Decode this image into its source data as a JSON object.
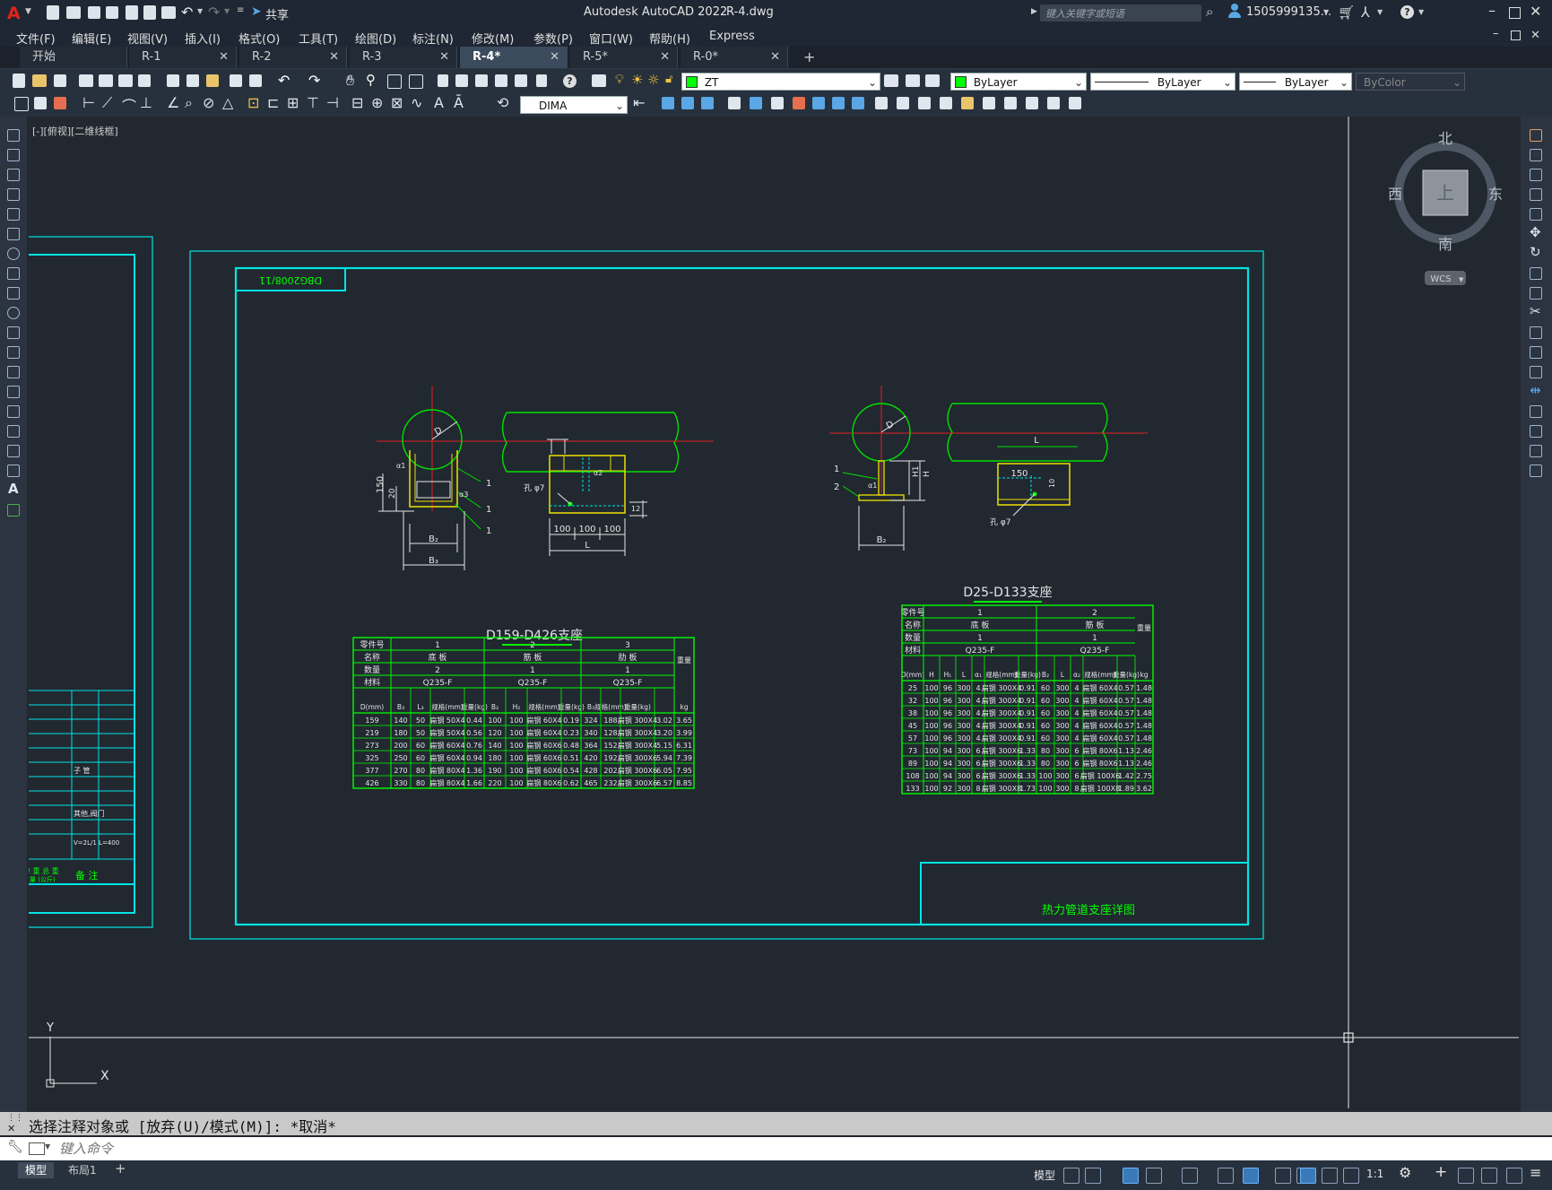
{
  "app": {
    "title": "Autodesk AutoCAD 2022",
    "filename": "R-4.dwg",
    "share_label": "共享",
    "search_placeholder": "键入关键字或短语",
    "user": "1505999135...",
    "accent": "#e2231a"
  },
  "menu": [
    "文件(F)",
    "编辑(E)",
    "视图(V)",
    "插入(I)",
    "格式(O)",
    "工具(T)",
    "绘图(D)",
    "标注(N)",
    "修改(M)",
    "参数(P)",
    "窗口(W)",
    "帮助(H)",
    "Express"
  ],
  "tabs": [
    {
      "label": "开始",
      "active": false,
      "close": false
    },
    {
      "label": "R-1",
      "active": false,
      "close": true
    },
    {
      "label": "R-2",
      "active": false,
      "close": true
    },
    {
      "label": "R-3",
      "active": false,
      "close": true
    },
    {
      "label": "R-4*",
      "active": true,
      "close": true
    },
    {
      "label": "R-5*",
      "active": false,
      "close": true
    },
    {
      "label": "R-0*",
      "active": false,
      "close": true
    }
  ],
  "toolbar": {
    "layer": "ZT",
    "color": "ByLayer",
    "linetype": "ByLayer",
    "lineweight": "ByLayer",
    "plotstyle": "ByColor",
    "dimstyle": "DIMA"
  },
  "viewport": {
    "label": "[-][俯视][二维线框]",
    "compass": {
      "n": "北",
      "s": "南",
      "e": "东",
      "w": "西",
      "center": "上"
    },
    "wcs": "WCS",
    "ucs_x": "X",
    "ucs_y": "Y"
  },
  "drawing": {
    "stamp": "DBG2008/11",
    "title_block": "热力管道支座详图",
    "left_caption": "D159-D426支座",
    "right_caption": "D25-D133支座",
    "left_callouts": [
      "1",
      "1",
      "1"
    ],
    "right_callouts": [
      "1",
      "2"
    ],
    "hole_label": "孔 φ7",
    "left_dims": {
      "h150": "150",
      "h20": "20",
      "b2": "B₂",
      "b3": "B₃",
      "d100a": "100",
      "d100b": "100",
      "d100c": "100",
      "L": "L",
      "D": "D",
      "a1": "α1",
      "a2": "α2",
      "a3": "α3",
      "h12": "12"
    },
    "right_dims": {
      "D": "D",
      "H1": "H1",
      "H": "H",
      "a1": "α1",
      "B2": "B₂",
      "L": "L",
      "d150": "150",
      "d10": "10"
    },
    "left_table": {
      "header1": [
        "零件号",
        "1",
        "2",
        "3",
        "重量"
      ],
      "header2": [
        "名称",
        "底 板",
        "筋 板",
        "肋 板"
      ],
      "header3": [
        "数量",
        "2",
        "1",
        "1"
      ],
      "header4": [
        "材料",
        "Q235-F",
        "Q235-F",
        "Q235-F"
      ],
      "colheads": [
        "D(mm)",
        "B₃",
        "L₃",
        "规格(mm)",
        "重量(kg)",
        "B₂",
        "H₂",
        "规格(mm)",
        "重量(kg)",
        "B₃",
        "规格(mm)",
        "重量(kg)",
        "kg"
      ],
      "rows": [
        [
          "159",
          "140",
          "50",
          "扁钢 50X4",
          "0.44",
          "100",
          "100",
          "扁钢 60X4",
          "0.19",
          "324",
          "188",
          "扁钢 300X4",
          "3.02",
          "3.65"
        ],
        [
          "219",
          "180",
          "50",
          "扁钢 50X4",
          "0.56",
          "120",
          "100",
          "扁钢 60X4",
          "0.23",
          "340",
          "128",
          "扁钢 300X4",
          "3.20",
          "3.99"
        ],
        [
          "273",
          "200",
          "60",
          "扁钢 60X4",
          "0.76",
          "140",
          "100",
          "扁钢 60X6",
          "0.48",
          "364",
          "152",
          "扁钢 300X4",
          "5.15",
          "6.31"
        ],
        [
          "325",
          "250",
          "60",
          "扁钢 60X4",
          "0.94",
          "180",
          "100",
          "扁钢 60X6",
          "0.51",
          "420",
          "192",
          "扁钢 300X6",
          "5.94",
          "7.39"
        ],
        [
          "377",
          "270",
          "80",
          "扁钢 80X4",
          "1.36",
          "190",
          "100",
          "扁钢 60X6",
          "0.54",
          "428",
          "202",
          "扁钢 300X6",
          "6.05",
          "7.95"
        ],
        [
          "426",
          "330",
          "80",
          "扁钢 80X4",
          "1.66",
          "220",
          "100",
          "扁钢 80X6",
          "0.62",
          "465",
          "232",
          "扁钢 300X6",
          "6.57",
          "8.85"
        ]
      ]
    },
    "right_table": {
      "header1": [
        "零件号",
        "1",
        "2",
        "重量"
      ],
      "header2": [
        "名称",
        "底 板",
        "筋 板"
      ],
      "header3": [
        "数量",
        "1",
        "1"
      ],
      "header4": [
        "材料",
        "Q235-F",
        "Q235-F"
      ],
      "colheads": [
        "D(mm)",
        "H",
        "H₁",
        "L",
        "α₁",
        "规格(mm)",
        "重量(kg)",
        "B₂",
        "L",
        "α₂",
        "规格(mm)",
        "重量(kg)",
        "kg"
      ],
      "rows": [
        [
          "25",
          "100",
          "96",
          "300",
          "4",
          "扁钢 300X4",
          "0.91",
          "60",
          "300",
          "4",
          "扁钢 60X4",
          "0.57",
          "1.48"
        ],
        [
          "32",
          "100",
          "96",
          "300",
          "4",
          "扁钢 300X4",
          "0.91",
          "60",
          "300",
          "4",
          "扁钢 60X4",
          "0.57",
          "1.48"
        ],
        [
          "38",
          "100",
          "96",
          "300",
          "4",
          "扁钢 300X4",
          "0.91",
          "60",
          "300",
          "4",
          "扁钢 60X4",
          "0.57",
          "1.48"
        ],
        [
          "45",
          "100",
          "96",
          "300",
          "4",
          "扁钢 300X4",
          "0.91",
          "60",
          "300",
          "4",
          "扁钢 60X4",
          "0.57",
          "1.48"
        ],
        [
          "57",
          "100",
          "96",
          "300",
          "4",
          "扁钢 300X4",
          "0.91",
          "60",
          "300",
          "4",
          "扁钢 60X4",
          "0.57",
          "1.48"
        ],
        [
          "73",
          "100",
          "94",
          "300",
          "6",
          "扁钢 300X6",
          "1.33",
          "80",
          "300",
          "6",
          "扁钢 80X6",
          "1.13",
          "2.46"
        ],
        [
          "89",
          "100",
          "94",
          "300",
          "6",
          "扁钢 300X6",
          "1.33",
          "80",
          "300",
          "6",
          "扁钢 80X6",
          "1.13",
          "2.46"
        ],
        [
          "108",
          "100",
          "94",
          "300",
          "6",
          "扁钢 300X6",
          "1.33",
          "100",
          "300",
          "6",
          "扁钢 100X6",
          "1.42",
          "2.75"
        ],
        [
          "133",
          "100",
          "92",
          "300",
          "8",
          "扁钢 300X8",
          "1.73",
          "100",
          "300",
          "8",
          "扁钢 100X8",
          "1.89",
          "3.62"
        ]
      ]
    },
    "side_sheet": {
      "l1": "子 管",
      "l2": "其他,阀门",
      "l3": "V=2L/1\nL=400",
      "l4": "单 重  总 重",
      "l5": "重量 (公斤)",
      "l6": "备 注"
    }
  },
  "command": {
    "history": "选择注释对象或 [放弃(U)/模式(M)]: *取消*",
    "placeholder": "键入命令"
  },
  "status": {
    "model_tab": "模型",
    "layout_tab": "布局1",
    "model_btn": "模型",
    "scale": "1:1"
  }
}
